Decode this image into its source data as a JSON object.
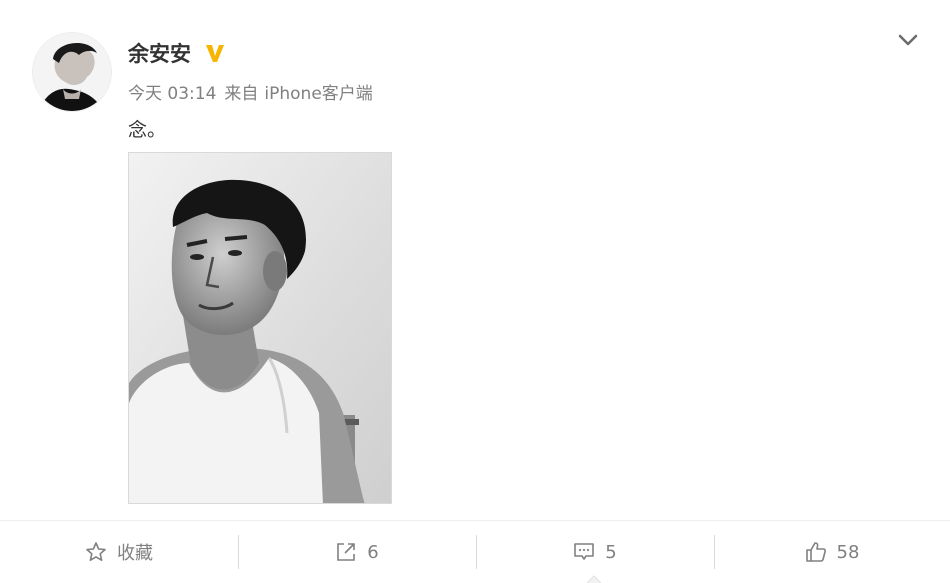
{
  "post": {
    "author": "余安安",
    "verified_badge_color": "#f7b500",
    "time": "今天 03:14",
    "source_prefix": "来自",
    "source": "iPhone客户端",
    "text": "念。"
  },
  "icons": {
    "menu": "chevron-down-icon",
    "verified": "verified-v-icon",
    "favorite": "star-icon",
    "repost": "share-icon",
    "comment": "comment-icon",
    "like": "thumbs-up-icon"
  },
  "actions": {
    "favorite_label": "收藏",
    "repost_count": "6",
    "comment_count": "5",
    "like_count": "58"
  }
}
